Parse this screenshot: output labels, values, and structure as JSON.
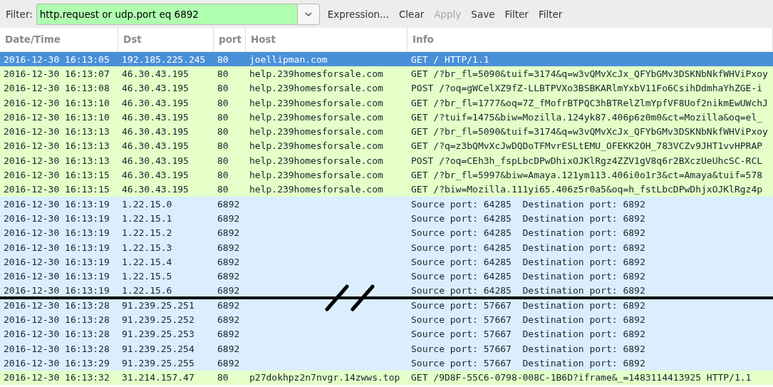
{
  "filter": {
    "label": "Filter:",
    "value": "http.request or udp.port eq 6892",
    "buttons": [
      {
        "label": "Expression...",
        "disabled": false
      },
      {
        "label": "Clear",
        "disabled": false
      },
      {
        "label": "Apply",
        "disabled": true
      },
      {
        "label": "Save",
        "disabled": false
      },
      {
        "label": "Filter",
        "disabled": false
      },
      {
        "label": "Filter",
        "disabled": false
      }
    ]
  },
  "table": {
    "columns": [
      "Date/Time",
      "Dst",
      "port",
      "Host",
      "Info"
    ],
    "rows": [
      {
        "kind": "http",
        "selected": true,
        "break_before": false,
        "cells": [
          "2016-12-30 16:13:05",
          "192.185.225.245",
          "80",
          "joellipman.com",
          "GET / HTTP/1.1"
        ]
      },
      {
        "kind": "http",
        "selected": false,
        "break_before": false,
        "cells": [
          "2016-12-30 16:13:07",
          "46.30.43.195",
          "80",
          "help.239homesforsale.com",
          "GET /?br_fl=5090&tuif=3174&q=w3vQMvXcJx_QFYbGMv3DSKNbNkfWHViPxoy"
        ]
      },
      {
        "kind": "http",
        "selected": false,
        "break_before": false,
        "cells": [
          "2016-12-30 16:13:08",
          "46.30.43.195",
          "80",
          "help.239homesforsale.com",
          "POST /?oq=gWCelXZ9fZ-LLBTPVXo3BSBKARlmYxbV11Fo6CsihDdmhaYhZGE-i"
        ]
      },
      {
        "kind": "http",
        "selected": false,
        "break_before": false,
        "cells": [
          "2016-12-30 16:13:10",
          "46.30.43.195",
          "80",
          "help.239homesforsale.com",
          "GET /?br_fl=1777&oq=7Z_fMofrBTPQC3hBTRelZlmYpfVF8Uof2nikmEwUWchJ"
        ]
      },
      {
        "kind": "http",
        "selected": false,
        "break_before": false,
        "cells": [
          "2016-12-30 16:13:10",
          "46.30.43.195",
          "80",
          "help.239homesforsale.com",
          "GET /?tuif=1475&biw=Mozilla.124yk87.406p6z0m0&ct=Mozilla&oq=el_"
        ]
      },
      {
        "kind": "http",
        "selected": false,
        "break_before": false,
        "cells": [
          "2016-12-30 16:13:13",
          "46.30.43.195",
          "80",
          "help.239homesforsale.com",
          "GET /?br_fl=5090&tuif=3174&q=w3vQMvXcJx_QFYbGMv3DSKNbNkfWHViPxoy"
        ]
      },
      {
        "kind": "http",
        "selected": false,
        "break_before": false,
        "cells": [
          "2016-12-30 16:13:13",
          "46.30.43.195",
          "80",
          "help.239homesforsale.com",
          "GET /?q=z3bQMvXcJwDQDoTFMvrESLtEMU_OFEKK2OH_783VCZv9JHT1vvHPRAP"
        ]
      },
      {
        "kind": "http",
        "selected": false,
        "break_before": false,
        "cells": [
          "2016-12-30 16:13:13",
          "46.30.43.195",
          "80",
          "help.239homesforsale.com",
          "POST /?oq=CEh3h_fspLbcDPwDhixOJKlRgz4ZZV1gV8q6r2BXczUeUhcSC-RCL"
        ]
      },
      {
        "kind": "http",
        "selected": false,
        "break_before": false,
        "cells": [
          "2016-12-30 16:13:15",
          "46.30.43.195",
          "80",
          "help.239homesforsale.com",
          "GET /?br_fl=5997&biw=Amaya.121ym113.406i0o1r3&ct=Amaya&tuif=578"
        ]
      },
      {
        "kind": "http",
        "selected": false,
        "break_before": false,
        "cells": [
          "2016-12-30 16:13:15",
          "46.30.43.195",
          "80",
          "help.239homesforsale.com",
          "GET /?biw=Mozilla.111yi65.406z5r0a5&oq=h_fstLbcDPwDhjxOJKlRgz4p"
        ]
      },
      {
        "kind": "udp",
        "selected": false,
        "break_before": false,
        "cells": [
          "2016-12-30 16:13:19",
          "1.22.15.0",
          "6892",
          "",
          "Source port: 64285  Destination port: 6892"
        ]
      },
      {
        "kind": "udp",
        "selected": false,
        "break_before": false,
        "cells": [
          "2016-12-30 16:13:19",
          "1.22.15.1",
          "6892",
          "",
          "Source port: 64285  Destination port: 6892"
        ]
      },
      {
        "kind": "udp",
        "selected": false,
        "break_before": false,
        "cells": [
          "2016-12-30 16:13:19",
          "1.22.15.2",
          "6892",
          "",
          "Source port: 64285  Destination port: 6892"
        ]
      },
      {
        "kind": "udp",
        "selected": false,
        "break_before": false,
        "cells": [
          "2016-12-30 16:13:19",
          "1.22.15.3",
          "6892",
          "",
          "Source port: 64285  Destination port: 6892"
        ]
      },
      {
        "kind": "udp",
        "selected": false,
        "break_before": false,
        "cells": [
          "2016-12-30 16:13:19",
          "1.22.15.4",
          "6892",
          "",
          "Source port: 64285  Destination port: 6892"
        ]
      },
      {
        "kind": "udp",
        "selected": false,
        "break_before": false,
        "cells": [
          "2016-12-30 16:13:19",
          "1.22.15.5",
          "6892",
          "",
          "Source port: 64285  Destination port: 6892"
        ]
      },
      {
        "kind": "udp",
        "selected": false,
        "break_before": false,
        "cells": [
          "2016-12-30 16:13:19",
          "1.22.15.6",
          "6892",
          "",
          "Source port: 64285  Destination port: 6892"
        ]
      },
      {
        "kind": "udp",
        "selected": false,
        "break_before": true,
        "cells": [
          "2016-12-30 16:13:28",
          "91.239.25.251",
          "6892",
          "",
          "Source port: 57667  Destination port: 6892"
        ]
      },
      {
        "kind": "udp",
        "selected": false,
        "break_before": false,
        "cells": [
          "2016-12-30 16:13:28",
          "91.239.25.252",
          "6892",
          "",
          "Source port: 57667  Destination port: 6892"
        ]
      },
      {
        "kind": "udp",
        "selected": false,
        "break_before": false,
        "cells": [
          "2016-12-30 16:13:28",
          "91.239.25.253",
          "6892",
          "",
          "Source port: 57667  Destination port: 6892"
        ]
      },
      {
        "kind": "udp",
        "selected": false,
        "break_before": false,
        "cells": [
          "2016-12-30 16:13:28",
          "91.239.25.254",
          "6892",
          "",
          "Source port: 57667  Destination port: 6892"
        ]
      },
      {
        "kind": "udp",
        "selected": false,
        "break_before": false,
        "cells": [
          "2016-12-30 16:13:29",
          "91.239.25.255",
          "6892",
          "",
          "Source port: 57667  Destination port: 6892"
        ]
      },
      {
        "kind": "http",
        "selected": false,
        "break_before": false,
        "cells": [
          "2016-12-30 16:13:32",
          "31.214.157.47",
          "80",
          "p27dokhpz2n7nvgr.14zwws.top",
          "GET /9D8F-55C6-0798-008C-1B6D?iframe&_=1483114413925 HTTP/1.1"
        ]
      }
    ]
  }
}
